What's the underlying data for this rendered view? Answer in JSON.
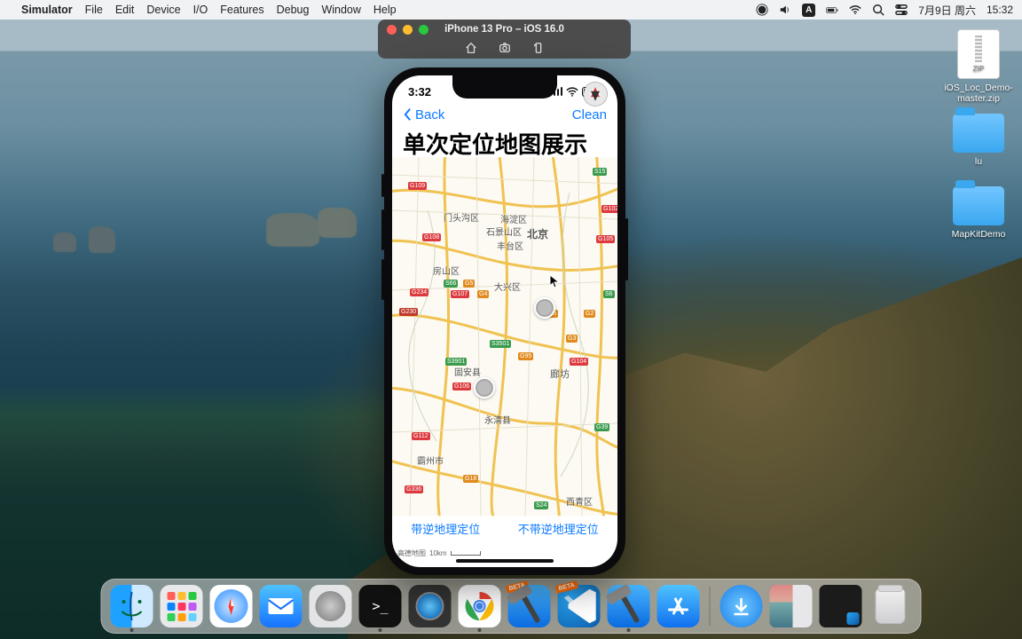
{
  "menubar": {
    "app": "Simulator",
    "items": [
      "File",
      "Edit",
      "Device",
      "I/O",
      "Features",
      "Debug",
      "Window",
      "Help"
    ],
    "ime_badge": "A",
    "date": "7月9日 周六",
    "time": "15:32"
  },
  "sim_window": {
    "title": "iPhone 13 Pro – iOS 16.0"
  },
  "phone": {
    "status_time": "3:32",
    "nav_back": "Back",
    "nav_action": "Clean",
    "page_title": "单次定位地图展示",
    "toolbar_left": "带逆地理定位",
    "toolbar_right": "不带逆地理定位",
    "map_attr": "高德地图",
    "map_scale": "10km"
  },
  "map_places": {
    "beijing": "北京",
    "haidian": "海淀区",
    "shijingshan": "石景山区",
    "fengtai": "丰台区",
    "mentougou": "门头沟区",
    "fangshan": "房山区",
    "daxing": "大兴区",
    "langfang": "廊坊",
    "guan": "固安县",
    "yongqing": "永清县",
    "bazhou": "霸州市",
    "xiqing": "西青区"
  },
  "map_routes": {
    "g109": "G109",
    "g108": "G108",
    "g107": "G107",
    "g234": "G234",
    "g230": "G230",
    "s66": "S66",
    "g5": "G5",
    "g4": "G4",
    "s3901": "S3901",
    "s3501": "S3501",
    "g45": "G45",
    "g3": "G3",
    "g95": "G95",
    "g106": "G106",
    "g2": "G2",
    "g18": "G18",
    "g336": "G336",
    "s24": "S24",
    "g112": "G112",
    "g104": "G104",
    "g39": "G39",
    "g105": "G105",
    "s6": "S6",
    "s15": "S15",
    "g102": "G102"
  },
  "desktop_icons": {
    "zip": "iOS_Loc_Demo-master.zip",
    "lu": "lu",
    "mapkit": "MapKitDemo"
  },
  "dock": {
    "apps": [
      "finder",
      "launchpad",
      "safari",
      "mail",
      "settings",
      "terminal",
      "quicktime",
      "chrome",
      "xcode-beta",
      "vscode-insiders",
      "xcode",
      "appstore"
    ],
    "beta": "BETA"
  }
}
